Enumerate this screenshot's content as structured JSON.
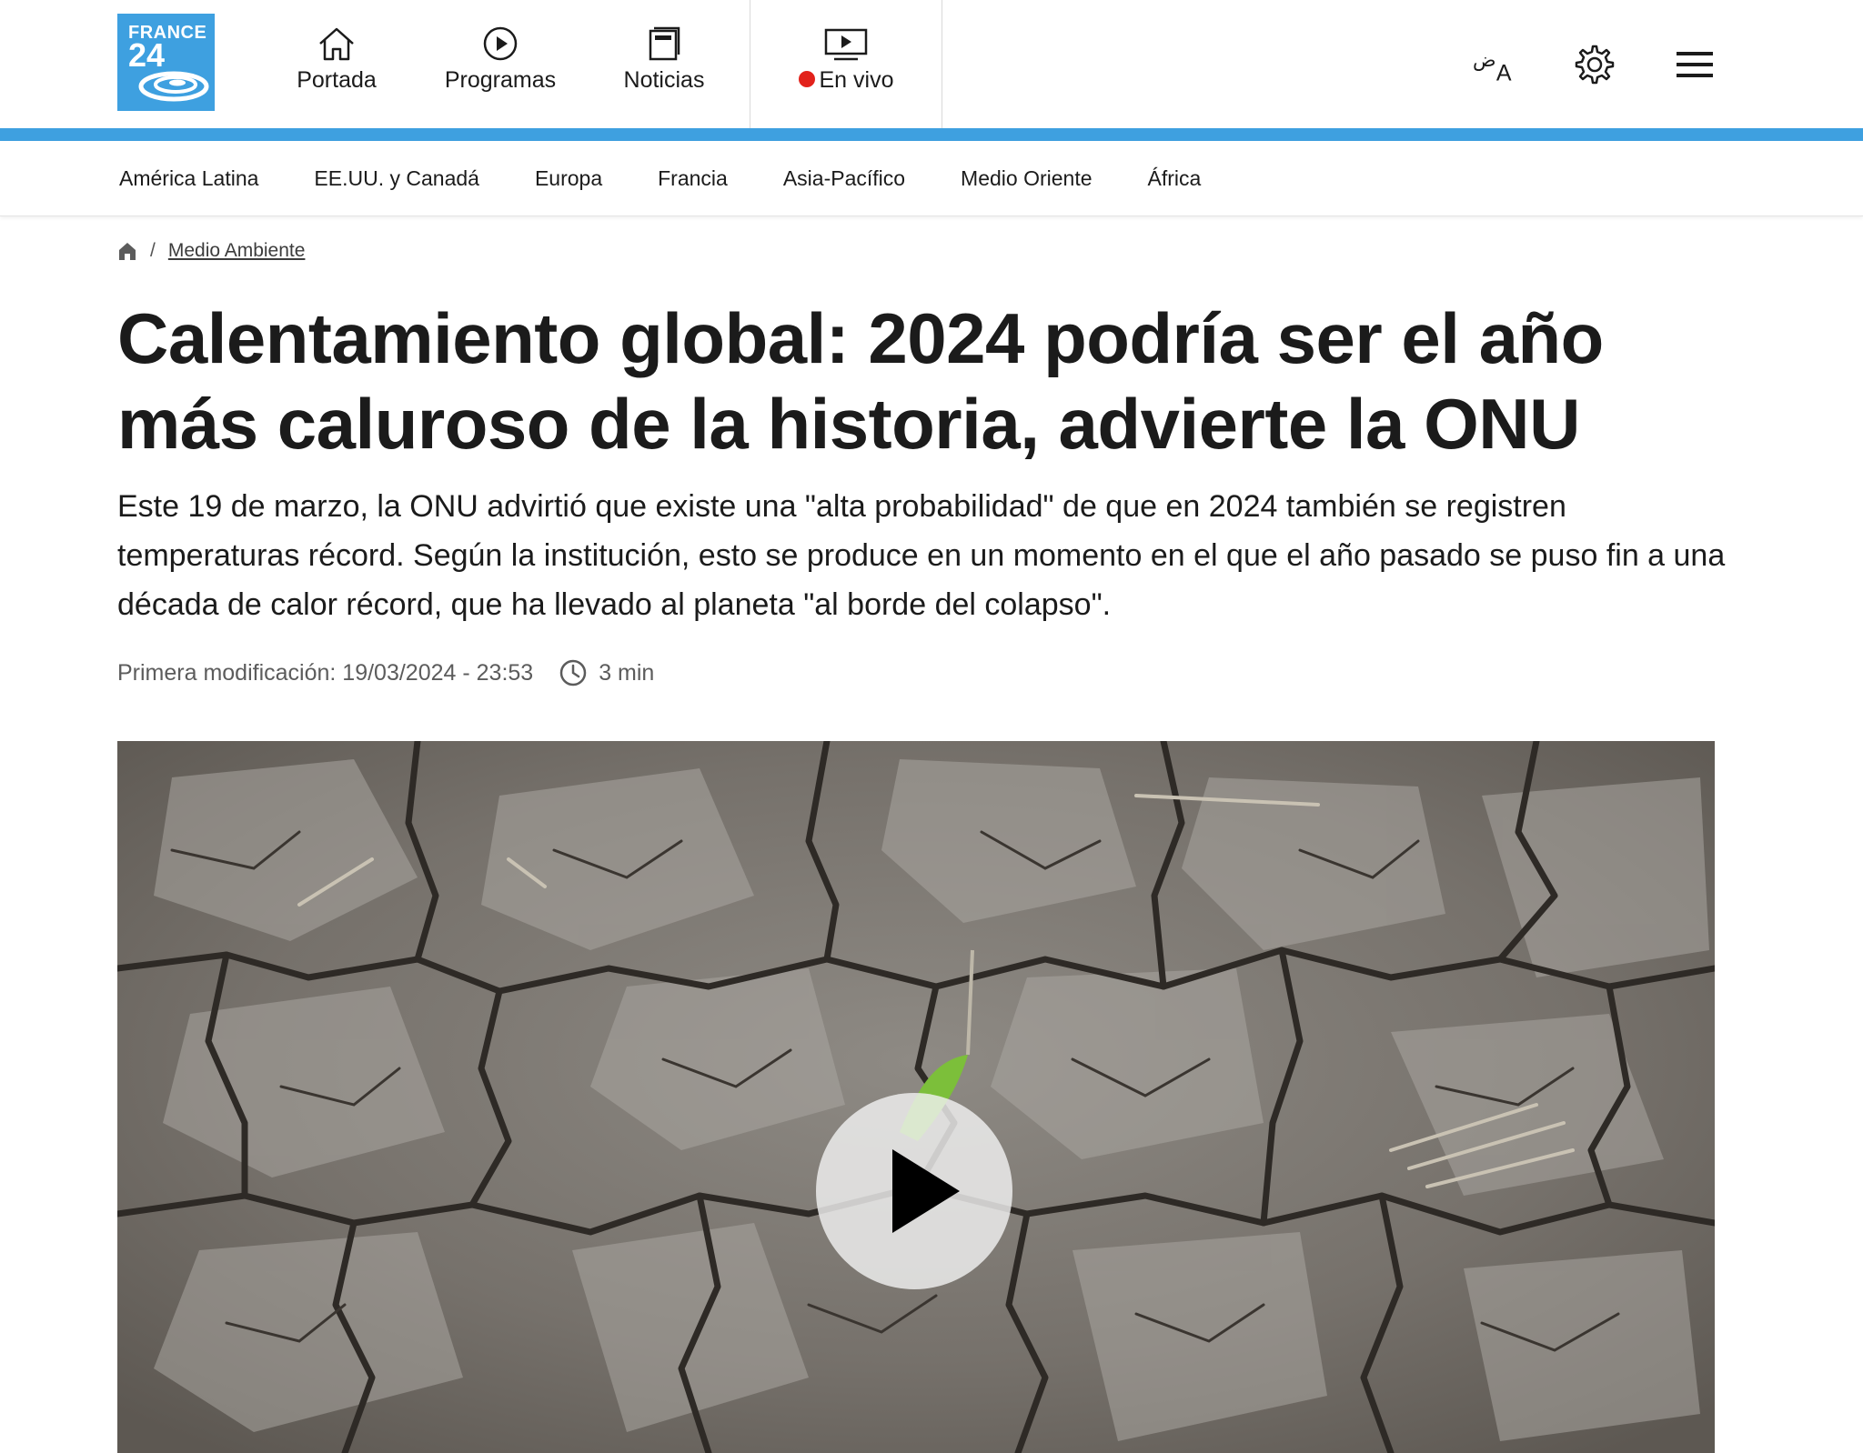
{
  "brand": {
    "logo_line1": "FRANCE",
    "logo_line2": "24",
    "color": "#3ea0e0"
  },
  "main_nav": [
    {
      "label": "Portada",
      "icon": "home-icon"
    },
    {
      "label": "Programas",
      "icon": "play-circle-icon"
    },
    {
      "label": "Noticias",
      "icon": "news-icon"
    },
    {
      "label": "En vivo",
      "icon": "tv-play-icon",
      "live_color": "#e2221b"
    }
  ],
  "header_tools": {
    "language_icon": "language-icon",
    "settings_icon": "gear-icon",
    "menu_icon": "hamburger-menu-icon"
  },
  "regions": [
    "América Latina",
    "EE.UU. y Canadá",
    "Europa",
    "Francia",
    "Asia-Pacífico",
    "Medio Oriente",
    "África"
  ],
  "breadcrumb": {
    "home_icon": "home-icon",
    "separator": "/",
    "section": "Medio Ambiente"
  },
  "article": {
    "title": "Calentamiento global: 2024 podría ser el año más caluroso de la historia, advierte la ONU",
    "lead": "Este 19 de marzo, la ONU advirtió que existe una \"alta probabilidad\" de que en 2024 también se registren temperaturas récord. Según la institución, esto se produce en un momento en el que el año pasado se puso fin a una década de calor récord, que ha llevado al planeta \"al borde del colapso\".",
    "modified": "Primera modificación: 19/03/2024 - 23:53",
    "read_time": "3 min"
  },
  "media": {
    "play_icon": "play-icon"
  }
}
